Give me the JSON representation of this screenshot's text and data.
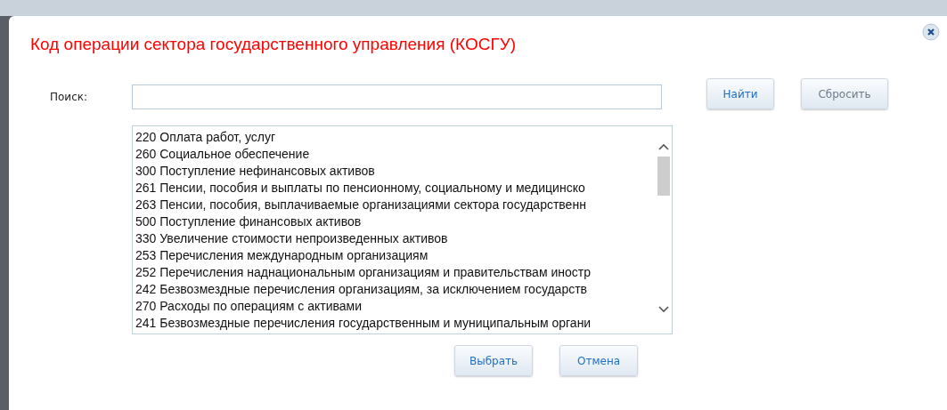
{
  "dialog": {
    "title": "Код операции сектора государственного управления (КОСГУ)"
  },
  "search": {
    "label": "Поиск:"
  },
  "search_buttons": [
    {
      "label": "Найти",
      "disabled": false
    },
    {
      "label": "Сбросить",
      "disabled": true
    }
  ],
  "list": {
    "items": [
      {
        "text": "220 Оплата работ, услуг",
        "selected": false
      },
      {
        "text": "260 Социальное обеспечение",
        "selected": false
      },
      {
        "text": "300 Поступление нефинансовых активов",
        "selected": false
      },
      {
        "text": "261 Пенсии, пособия и выплаты по пенсионному, социальному и медицинско",
        "selected": false
      },
      {
        "text": "263 Пенсии, пособия, выплачиваемые организациями сектора государственн",
        "selected": false
      },
      {
        "text": "500 Поступление финансовых активов",
        "selected": false
      },
      {
        "text": "330 Увеличение стоимости непроизведенных активов",
        "selected": false
      },
      {
        "text": "253 Перечисления международным организациям",
        "selected": false
      },
      {
        "text": "252 Перечисления наднациональным организациям и правительствам иностр",
        "selected": false
      },
      {
        "text": "242 Безвозмездные перечисления организациям, за исключением государств",
        "selected": false
      },
      {
        "text": "270 Расходы по операциям с активами",
        "selected": false
      },
      {
        "text": "241 Безвозмездные перечисления государственным и муниципальным органи",
        "selected": false
      }
    ]
  },
  "footer_buttons": [
    {
      "label": "Выбрать",
      "disabled": false
    },
    {
      "label": "Отмена",
      "disabled": false
    }
  ]
}
